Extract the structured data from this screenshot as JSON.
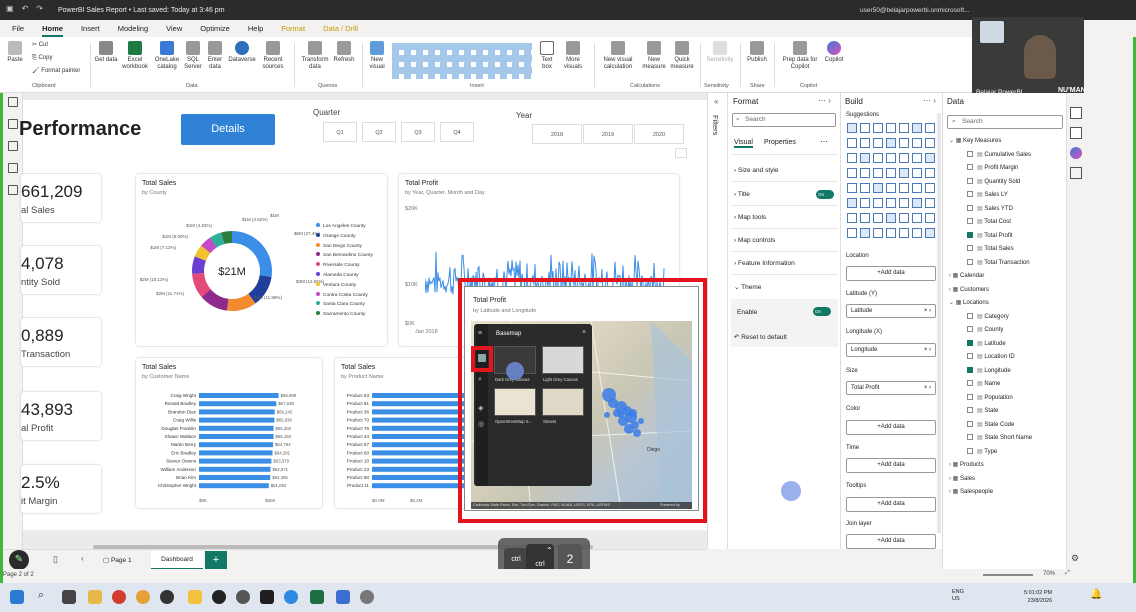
{
  "titlebar": {
    "title": "PowerBI Sales Report • Last saved: Today at 3:46 pm",
    "user": "user50@belajarpowerbi.onmicrosoft..."
  },
  "menu": {
    "items": [
      "File",
      "Home",
      "Insert",
      "Modeling",
      "View",
      "Optimize",
      "Help",
      "Format",
      "Data / Drill"
    ],
    "active": "Home"
  },
  "ribbon": {
    "buttons": [
      {
        "label": "Paste"
      },
      {
        "label": "Cut"
      },
      {
        "label": "Copy"
      },
      {
        "label": "Format painter"
      },
      {
        "label": "Get data"
      },
      {
        "label": "Excel workbook"
      },
      {
        "label": "OneLake catalog"
      },
      {
        "label": "SQL Server"
      },
      {
        "label": "Enter data"
      },
      {
        "label": "Dataverse"
      },
      {
        "label": "Recent sources"
      },
      {
        "label": "Transform data"
      },
      {
        "label": "Refresh"
      },
      {
        "label": "New visual"
      },
      {
        "label": "Text box"
      },
      {
        "label": "More visuals"
      },
      {
        "label": "New visual calculation"
      },
      {
        "label": "New measure"
      },
      {
        "label": "Quick measure"
      },
      {
        "label": "Sensitivity"
      },
      {
        "label": "Publish"
      },
      {
        "label": "Prep data for Copilot"
      },
      {
        "label": "Copilot"
      }
    ],
    "groups": [
      "Clipboard",
      "Data",
      "Queries",
      "Insert",
      "Calculations",
      "Sensitivity",
      "Share",
      "Copilot"
    ]
  },
  "report": {
    "title": "Performance",
    "details_button": "Details",
    "quarter_label": "Quarter",
    "quarters": [
      "Q1",
      "Q2",
      "Q3",
      "Q4"
    ],
    "year_label": "Year",
    "years": [
      "2018",
      "2019",
      "2020"
    ],
    "kpis": [
      {
        "value": "661,209",
        "label": "al Sales"
      },
      {
        "value": "4,078",
        "label": "ntity Sold"
      },
      {
        "value": "0,889",
        "label": "Transaction"
      },
      {
        "value": "43,893",
        "label": "al Profit"
      },
      {
        "value": "2.5%",
        "label": "it Margin"
      }
    ],
    "donut": {
      "title": "Total Sales",
      "subtitle": "by County",
      "center": "$21M",
      "labels": [
        "$1M",
        "$1M (4.82%)",
        "$1M (4.83%)",
        "$1M (5.00%)",
        "$1M (7.12%)",
        "$2M (10.12%)",
        "$2M (11.71%)",
        "$2M (11.98%)",
        "$3M (12.65%)",
        "$6M (27.4%)"
      ],
      "legend": [
        "Los Angeles County",
        "Orange County",
        "San Diego County",
        "San Bernardino County",
        "Riverside County",
        "Alameda County",
        "Ventura County",
        "Contra Costa County",
        "Santa Clara County",
        "Sacramento County"
      ]
    },
    "profit_line": {
      "title": "Total Profit",
      "subtitle": "by Year, Quarter, Month and Day",
      "yticks": [
        "$20K",
        "$10K",
        "$0K"
      ],
      "xtick": "Jan 2018"
    },
    "customers": {
      "title": "Total Sales",
      "subtitle": "by Customer Name",
      "names": [
        "Craig Wright",
        "Ronald Bradley",
        "Brandon Diaz",
        "Craig Willis",
        "Douglas Franklin",
        "Shawn Wallace",
        "Martin Berry",
        "Eric Bradley",
        "Steven Owens",
        "William Anderson",
        "Brian Kim",
        "Christopher Wright"
      ],
      "values": [
        "$69,689",
        "$67,638",
        "$66,242",
        "$65,936",
        "$65,202",
        "$65,193",
        "$64,794",
        "$64,281",
        "$63,379",
        "$62,571",
        "$62,305",
        "$61,062"
      ],
      "xticks": [
        "$0K",
        "$50K"
      ]
    },
    "products": {
      "title": "Total Sales",
      "subtitle": "by Product Name",
      "names": [
        "Product 63",
        "Product 81",
        "Product 36",
        "Product 70",
        "Product 76",
        "Product 44",
        "Product 67",
        "Product 60",
        "Product 10",
        "Product 23",
        "Product 90",
        "Product 11"
      ],
      "xticks": [
        "$0.0M",
        "$0.2M"
      ]
    },
    "map": {
      "title": "Total Profit",
      "subtitle": "by Latitude and Longitude",
      "basemap_title": "Basemap",
      "basemaps": [
        "Dark Grey Canvas",
        "Light Grey Canvas",
        "OpenStreetMap S...",
        "Streets"
      ],
      "city": "Diego",
      "attribution": "California State Parks, Esri, TomTom, Garmin, FAO, NOAA, USGS, EPA, USFWS",
      "powered": "Powered by"
    },
    "pages": [
      "Page 1",
      "Dashboard"
    ],
    "active_page": "Dashboard",
    "page_counter": "Page 2 of 2"
  },
  "filters_label": "Filters",
  "format_pane": {
    "title": "Format",
    "search_placeholder": "Search",
    "tabs": [
      "Visual",
      "Properties"
    ],
    "sections": [
      "Size and style",
      "Title",
      "Map tools",
      "Map controls",
      "Feature Information",
      "Theme"
    ],
    "title_toggle": "On",
    "enable_label": "Enable",
    "enable_toggle": "On",
    "reset": "Reset to default"
  },
  "build_pane": {
    "title": "Build",
    "suggestions": "Suggestions",
    "wells": [
      {
        "label": "Location",
        "value": "+Add data"
      },
      {
        "label": "Latitude (Y)",
        "value": "Latitude"
      },
      {
        "label": "Longitude (X)",
        "value": "Longitude"
      },
      {
        "label": "Size",
        "value": "Total Profit"
      },
      {
        "label": "Color",
        "value": "+Add data"
      },
      {
        "label": "Time",
        "value": "+Add data"
      },
      {
        "label": "Tooltips",
        "value": "+Add data"
      },
      {
        "label": "Join layer",
        "value": "+Add data"
      },
      {
        "label": "Find similar",
        "value": ""
      }
    ]
  },
  "data_pane": {
    "title": "Data",
    "search_placeholder": "Search",
    "tree": [
      {
        "label": "Key Measures",
        "level": 0,
        "type": "table"
      },
      {
        "label": "Cumulative Sales",
        "level": 1,
        "checked": false
      },
      {
        "label": "Profit Margin",
        "level": 1,
        "checked": false
      },
      {
        "label": "Quantity Sold",
        "level": 1,
        "checked": false
      },
      {
        "label": "Sales LY",
        "level": 1,
        "checked": false
      },
      {
        "label": "Sales YTD",
        "level": 1,
        "checked": false
      },
      {
        "label": "Total Cost",
        "level": 1,
        "checked": false
      },
      {
        "label": "Total Profit",
        "level": 1,
        "checked": true
      },
      {
        "label": "Total Sales",
        "level": 1,
        "checked": false
      },
      {
        "label": "Total Transaction",
        "level": 1,
        "checked": false
      },
      {
        "label": "Calendar",
        "level": 0,
        "type": "table"
      },
      {
        "label": "Customers",
        "level": 0,
        "type": "table"
      },
      {
        "label": "Locations",
        "level": 0,
        "type": "table"
      },
      {
        "label": "Category",
        "level": 1,
        "checked": false
      },
      {
        "label": "County",
        "level": 1,
        "checked": false
      },
      {
        "label": "Latitude",
        "level": 1,
        "checked": true
      },
      {
        "label": "Location ID",
        "level": 1,
        "checked": false
      },
      {
        "label": "Longitude",
        "level": 1,
        "checked": true
      },
      {
        "label": "Name",
        "level": 1,
        "checked": false
      },
      {
        "label": "Population",
        "level": 1,
        "checked": false
      },
      {
        "label": "State",
        "level": 1,
        "checked": false
      },
      {
        "label": "State Code",
        "level": 1,
        "checked": false
      },
      {
        "label": "State Short Name",
        "level": 1,
        "checked": false
      },
      {
        "label": "Type",
        "level": 1,
        "checked": false
      },
      {
        "label": "Products",
        "level": 0,
        "type": "table"
      },
      {
        "label": "Sales",
        "level": 0,
        "type": "table"
      },
      {
        "label": "Salespeople",
        "level": 0,
        "type": "table"
      }
    ]
  },
  "status": {
    "zoom": "70%"
  },
  "webcam": {
    "caption": "Belajar PowerBI",
    "brand": "NU'MAN"
  },
  "keystroke": {
    "keys": [
      "ctrl",
      "ctrl",
      "2"
    ]
  },
  "taskbar": {
    "lang": "ENG\nUS",
    "time": "5:01:02 PM",
    "date": "23/8/2026"
  },
  "colors": {
    "accent": "#117865",
    "highlight": "#e3141b",
    "chartBlue": "#3a8ee6"
  }
}
